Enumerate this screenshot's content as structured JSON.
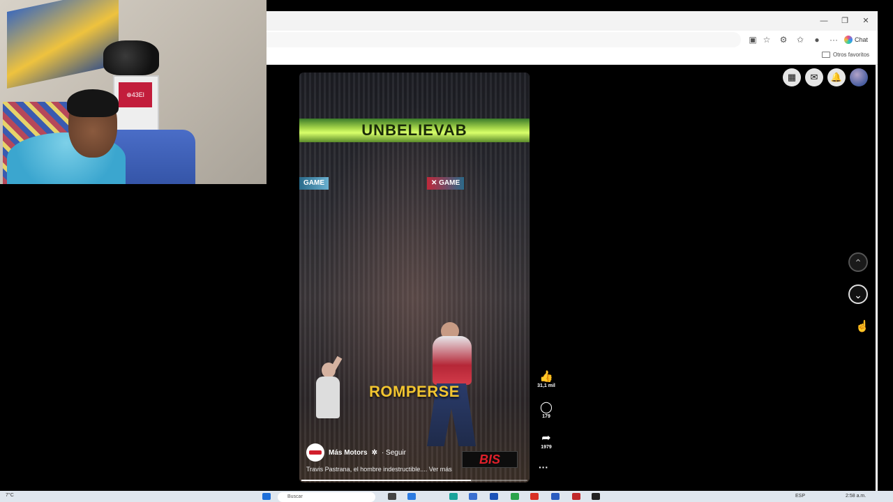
{
  "webcam": {
    "box_label": "⊕43El"
  },
  "browser": {
    "window_controls": {
      "minimize": "—",
      "maximize": "❐",
      "close": "✕"
    },
    "toolbar": {
      "chat_label": "Chat",
      "more_icon": "···"
    },
    "favorites": {
      "folder_label": "Otros favoritos"
    }
  },
  "video": {
    "banner_text": "UNBELIEVAB",
    "scoreboard_left": "GAME",
    "scoreboard_right": "✕ GAME",
    "caption_word": "ROMPERSE",
    "watermark": "BIS",
    "author": "Más Motors",
    "follow_label": "· Seguir",
    "description": "Travis Pastrana, el hombre indestructible....",
    "see_more": "Ver más",
    "progress": 0.75
  },
  "actions": {
    "likes": "31,1 mil",
    "comments": "179",
    "shares": "1979",
    "more": "···"
  },
  "nav": {
    "up_icon": "⌃",
    "down_icon": "⌄"
  },
  "taskbar": {
    "weather": "7°C",
    "search_placeholder": "Buscar",
    "language": "ESP",
    "time": "2:58 a.m."
  },
  "colors": {
    "caption": "#f2c530",
    "watermark": "#e0202a",
    "banner": "#a6d64a"
  }
}
